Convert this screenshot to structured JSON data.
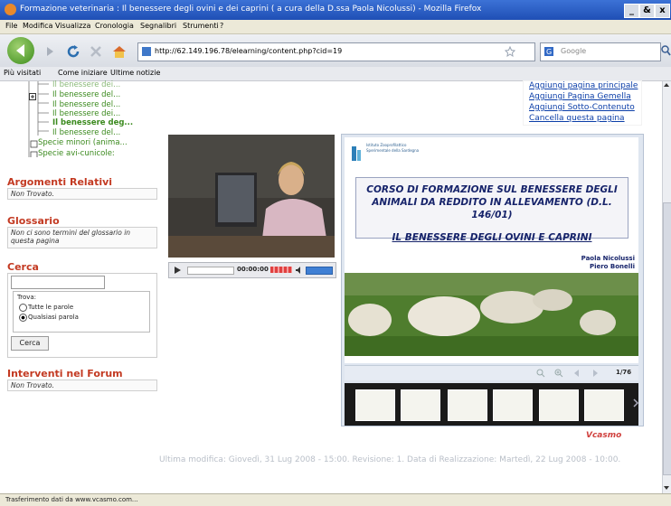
{
  "window": {
    "title": "Formazione veterinaria : Il benessere degli ovini e dei caprini ( a cura della D.ssa Paola Nicolussi) - Mozilla Firefox",
    "controls": [
      "_",
      "&",
      "x"
    ]
  },
  "menu": [
    "File",
    "Modifica",
    "Visualizza",
    "Cronologia",
    "Segnalibri",
    "Strumenti",
    "?"
  ],
  "nav": {
    "url": "http://62.149.196.78/elearning/content.php?cid=19",
    "search_placeholder": "Google"
  },
  "bookmarks": [
    "Più visitati",
    "Come iniziare",
    "Ultime notizie"
  ],
  "tree": {
    "items": [
      "Il benessere dei...",
      "Il benessere del...",
      "Il benessere del...",
      "Il benessere dei...",
      "Il benessere deg...",
      "Il benessere del...",
      "Specie minori (anima...",
      "Specie avi-cunicole:"
    ]
  },
  "sidebar": {
    "related_title": "Argomenti Relativi",
    "related_text": "Non Trovato.",
    "glossary_title": "Glossario",
    "glossary_text": "Non ci sono termini del glossario in questa pagina",
    "search_title": "Cerca",
    "search_value": "",
    "search_options_label": "Trova:",
    "option_all": "Tutte le parole",
    "option_any": "Qualsiasi parola",
    "search_button": "Cerca",
    "forum_title": "Interventi nel Forum",
    "forum_text": "Non Trovato."
  },
  "actions": [
    "Aggiungi pagina principale",
    "Aggiungi Pagina Gemella",
    "Aggiungi Sotto-Contenuto",
    "Cancella questa pagina"
  ],
  "video": {
    "time": "00:00:00"
  },
  "slide": {
    "header_text": "Istituto Zooprofilattico Sperimentale della Sardegna",
    "title": "CORSO DI FORMAZIONE SUL BENESSERE DEGLI ANIMALI DA REDDITO IN ALLEVAMENTO (D.L. 146/01)",
    "subtitle": "IL BENESSERE DEGLI OVINI E CAPRINI",
    "author1": "Paola Nicolussi",
    "author2": "Piero Bonelli",
    "counter": "1/76",
    "thumb_count": 6
  },
  "brand": "Vcasmo",
  "footer": "Ultima modifica: Giovedì, 31 Lug 2008 - 15:00. Revisione: 1. Data di Realizzazione: Martedì, 22 Lug 2008 - 10:00.",
  "status": "Trasferimento dati da www.vcasmo.com...",
  "colors": {
    "accent_red": "#c33a22",
    "tree_green": "#3b8a1e",
    "link_blue": "#0b3ea8",
    "slide_title": "#17246b"
  }
}
